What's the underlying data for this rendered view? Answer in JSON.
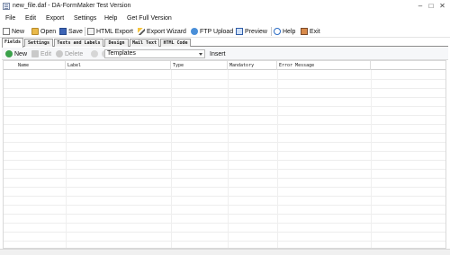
{
  "window": {
    "title": "new_file.daf - DA-FormMaker  Test Version",
    "minimize": "–",
    "maximize": "□",
    "close": "✕"
  },
  "menu": [
    "File",
    "Edit",
    "Export",
    "Settings",
    "Help",
    "Get Full Version"
  ],
  "toolbar": {
    "new": "New",
    "open": "Open",
    "save": "Save",
    "html_export": "HTML Export",
    "export_wizard": "Export Wizard",
    "ftp_upload": "FTP Upload",
    "preview": "Preview",
    "help": "Help",
    "exit": "Exit"
  },
  "tabs": [
    "Fields",
    "Settings",
    "Texts and Labels",
    "Design",
    "Mail Text",
    "HTML Code"
  ],
  "subtoolbar": {
    "new": "New",
    "edit": "Edit",
    "delete": "Delete",
    "templates": "Templates",
    "insert": "Insert"
  },
  "grid": {
    "columns": [
      "Name",
      "Label",
      "Type",
      "Mandatory",
      "Error Message"
    ]
  },
  "colors": {
    "accent": "#2b6cc4",
    "new_green": "#3aa14a",
    "delete_grey": "#9a9a9a"
  }
}
